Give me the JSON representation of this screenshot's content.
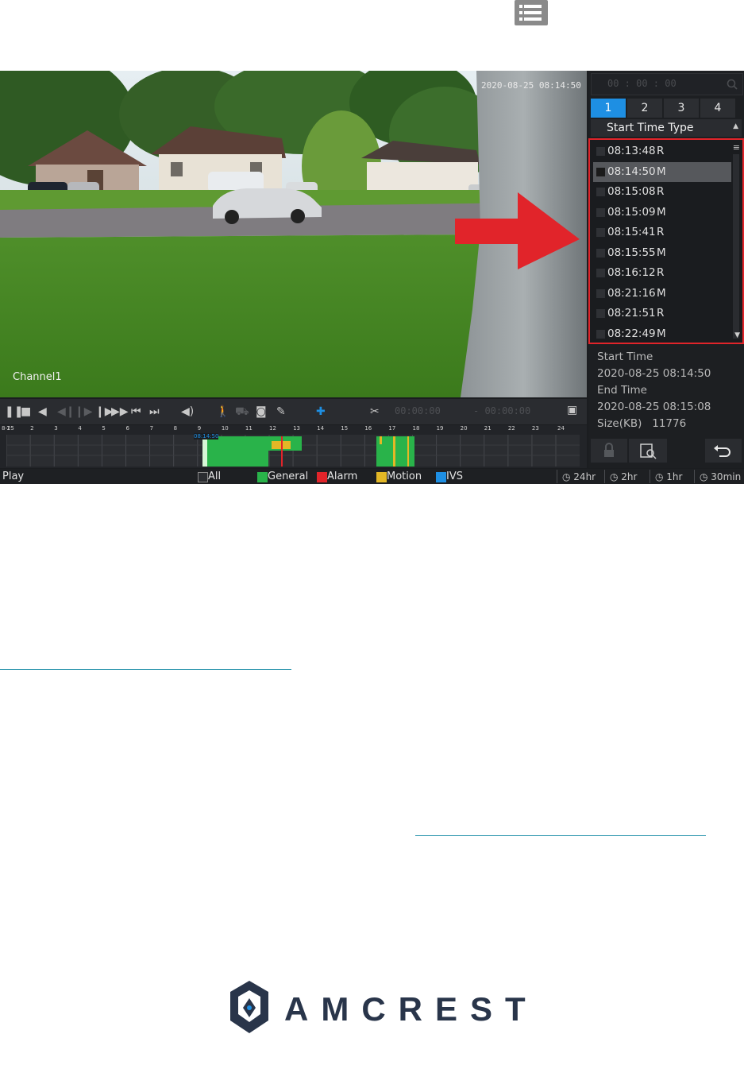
{
  "player": {
    "timestamp": "2020-08-25 08:14:50",
    "channel_label": "Channel1",
    "clip_start": "00:00:00",
    "clip_end": "- 00:00:00",
    "search_time": "00 :  00 :  00",
    "channel_tabs": [
      "1",
      "2",
      "3",
      "4"
    ],
    "active_tab": "1",
    "list_header": "Start Time Type",
    "records": [
      {
        "time": "08:13:48",
        "type": "R"
      },
      {
        "time": "08:14:50",
        "type": "M"
      },
      {
        "time": "08:15:08",
        "type": "R"
      },
      {
        "time": "08:15:09",
        "type": "M"
      },
      {
        "time": "08:15:41",
        "type": "R"
      },
      {
        "time": "08:15:55",
        "type": "M"
      },
      {
        "time": "08:16:12",
        "type": "R"
      },
      {
        "time": "08:21:16",
        "type": "M"
      },
      {
        "time": "08:21:51",
        "type": "R"
      },
      {
        "time": "08:22:49",
        "type": "M"
      }
    ],
    "selected_index": 1,
    "info": {
      "start_label": "Start Time",
      "start_value": "2020-08-25 08:14:50",
      "end_label": "End Time",
      "end_value": "2020-08-25 08:15:08",
      "size_label": "Size(KB)",
      "size_value": "11776"
    },
    "timeline": {
      "date_label": "8-25",
      "hours": [
        "1",
        "2",
        "3",
        "4",
        "5",
        "6",
        "7",
        "8",
        "9",
        "10",
        "11",
        "12",
        "13",
        "14",
        "15",
        "16",
        "17",
        "18",
        "19",
        "20",
        "21",
        "22",
        "23",
        "24"
      ],
      "cursor_label": "08:14:50"
    },
    "legend": {
      "status": "Play",
      "all": "All",
      "general": "General",
      "alarm": "Alarm",
      "motion": "Motion",
      "ivs": "IVS",
      "colors": {
        "general": "#29b34a",
        "alarm": "#e1242a",
        "motion": "#e3b726",
        "ivs": "#1e8fe3"
      }
    },
    "zoom": [
      "24hr",
      "2hr",
      "1hr",
      "30min"
    ]
  },
  "icons": [
    "list-icon",
    "search-icon",
    "scissors-icon",
    "save-icon",
    "lock-icon",
    "search-file-icon",
    "back-icon",
    "person-icon",
    "camera-icon",
    "pin-icon",
    "volume-icon"
  ],
  "logo": {
    "text": "AMCREST"
  },
  "accent_colors": {
    "annotation_red": "#e1242a",
    "link_teal": "#1f8fa8"
  }
}
